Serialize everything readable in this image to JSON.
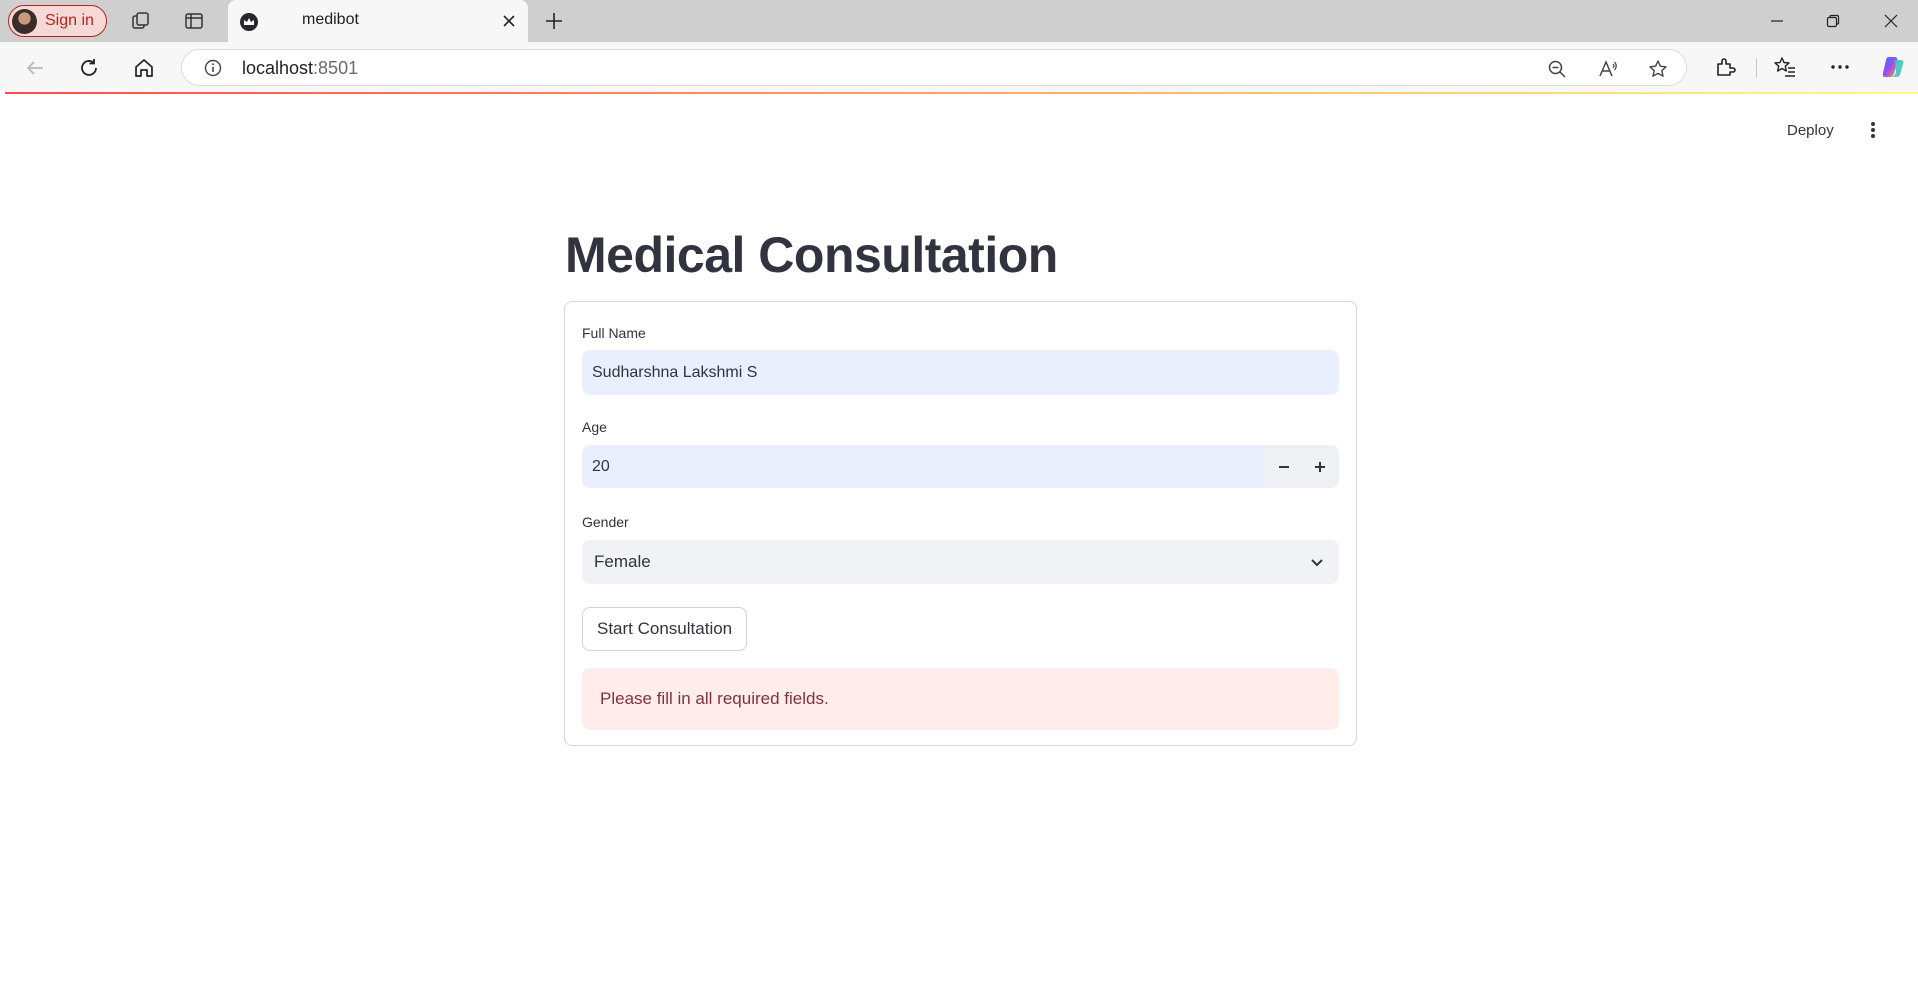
{
  "browser": {
    "sign_in_label": "Sign in",
    "tab_title": "medibot",
    "url_host": "localhost",
    "url_port": ":8501"
  },
  "app": {
    "deploy_label": "Deploy",
    "title": "Medical Consultation",
    "form": {
      "full_name_label": "Full Name",
      "full_name_value": "Sudharshna Lakshmi S",
      "age_label": "Age",
      "age_value": "20",
      "gender_label": "Gender",
      "gender_value": "Female",
      "submit_label": "Start Consultation",
      "error_message": "Please fill in all required fields."
    }
  },
  "colors": {
    "error_background": "#ffeceb",
    "error_text": "#7d353b",
    "input_background": "#e9effc",
    "heading_text": "#31333f",
    "signin_accent": "#b3261e"
  }
}
